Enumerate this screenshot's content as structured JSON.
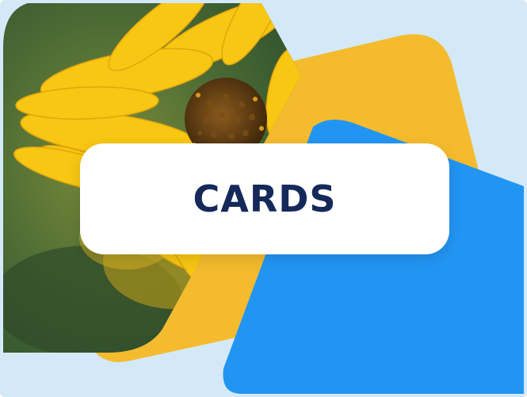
{
  "title": "CARDS",
  "colors": {
    "background": "#d4e9f8",
    "yellow_card": "#f4bb2e",
    "blue_card": "#2295f3",
    "title_text": "#15295a",
    "petal": "#f7c713",
    "petal_dark": "#e3a50c",
    "flower_center": "#5b3a12",
    "photo_background": "#3f5a2e"
  },
  "images": {
    "photo": "sunflower-photo"
  }
}
